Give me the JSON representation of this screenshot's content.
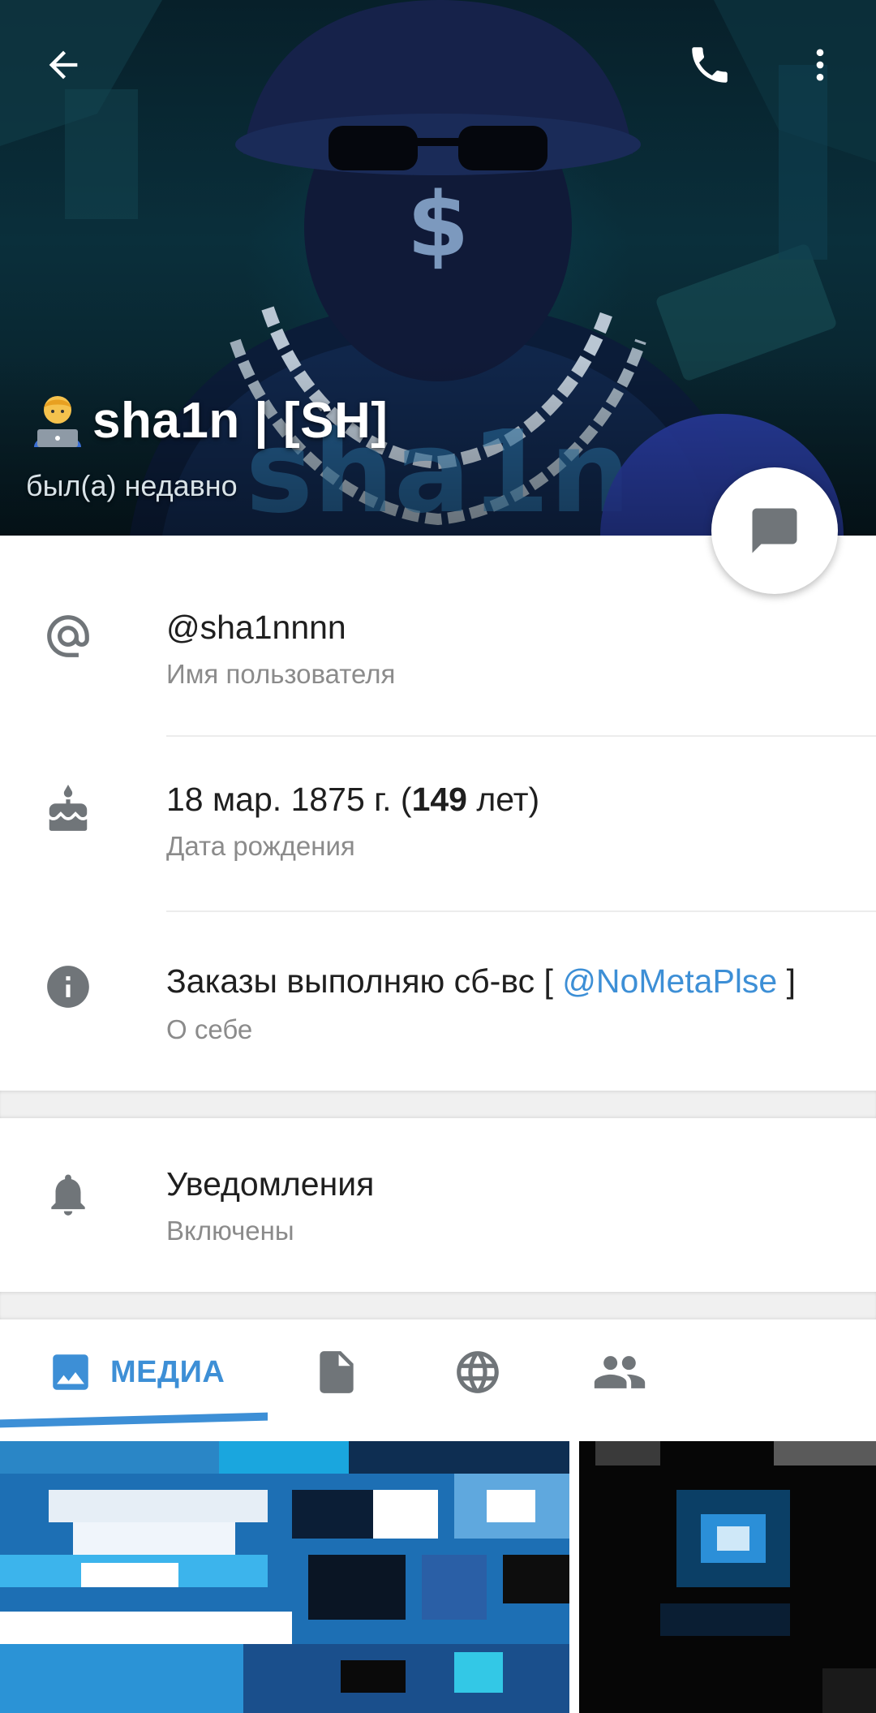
{
  "header": {
    "name": "sha1n | [SH]",
    "status": "был(а) недавно"
  },
  "icons": {
    "back": "arrow-back-icon",
    "call": "phone-icon",
    "more": "more-vert-icon",
    "message": "message-icon",
    "username": "at-sign-icon",
    "birthday": "cake-icon",
    "bio": "info-icon",
    "notifications": "bell-icon",
    "tab_media": "image-icon",
    "tab_files": "file-icon",
    "tab_links": "globe-icon",
    "tab_groups": "people-icon"
  },
  "info": {
    "username": {
      "value": "@sha1nnnn",
      "label": "Имя пользователя"
    },
    "birthday": {
      "date": "18 мар. 1875 г. (",
      "age": "149",
      "suffix": " лет)",
      "label": "Дата рождения"
    },
    "bio": {
      "text": "Заказы выполняю сб-вс [ ",
      "mention": "@NoMetaPlse",
      "end": " ]",
      "label": "О себе"
    }
  },
  "notifications": {
    "title": "Уведомления",
    "value": "Включены"
  },
  "tabs": {
    "media_label": "МЕДИА"
  },
  "colors": {
    "accent": "#3d8fd6",
    "icon_gray": "#707579",
    "secondary_text": "#8b8b8b"
  }
}
